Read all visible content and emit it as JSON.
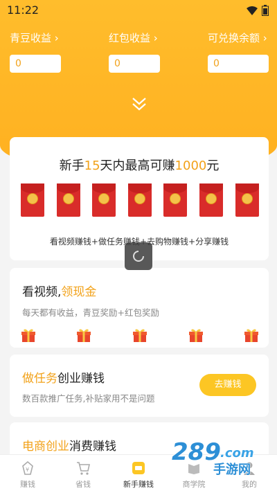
{
  "status": {
    "time": "11:22"
  },
  "earnings": [
    {
      "label": "青豆收益",
      "value": "0"
    },
    {
      "label": "红包收益",
      "value": "0"
    },
    {
      "label": "可兑换余额",
      "value": "0"
    }
  ],
  "promo": {
    "title_prefix": "新手",
    "title_days": "15",
    "title_mid": "天内最高可赚",
    "title_amount": "1000",
    "title_suffix": "元",
    "subtitle": "看视频赚钱+做任务赚钱+去购物赚钱+分享赚钱"
  },
  "video_card": {
    "title_main": "看视频,",
    "title_accent": "领现金",
    "desc": "每天都有收益，青豆奖励+红包奖励"
  },
  "task_card": {
    "title_accent": "做任务",
    "title_main": "创业赚钱",
    "desc": "数百款推广任务,补贴家用不是问题",
    "button": "去赚钱"
  },
  "ecom_card": {
    "title_accent": "电商创业",
    "title_main": "消费赚钱"
  },
  "watermark": {
    "number": "289",
    "suffix": ".com",
    "text": "手游网"
  },
  "tabs": [
    {
      "label": "赚钱",
      "icon": "earn-icon",
      "active": false
    },
    {
      "label": "省钱",
      "icon": "cart-icon",
      "active": false
    },
    {
      "label": "新手赚钱",
      "icon": "newbie-icon",
      "active": true
    },
    {
      "label": "商学院",
      "icon": "book-icon",
      "active": false
    },
    {
      "label": "我的",
      "icon": "person-icon",
      "active": false
    }
  ],
  "colors": {
    "accent": "#f2a21a",
    "header": "#ffb020",
    "red_envelope": "#d92c2a",
    "button": "#fcc624"
  }
}
